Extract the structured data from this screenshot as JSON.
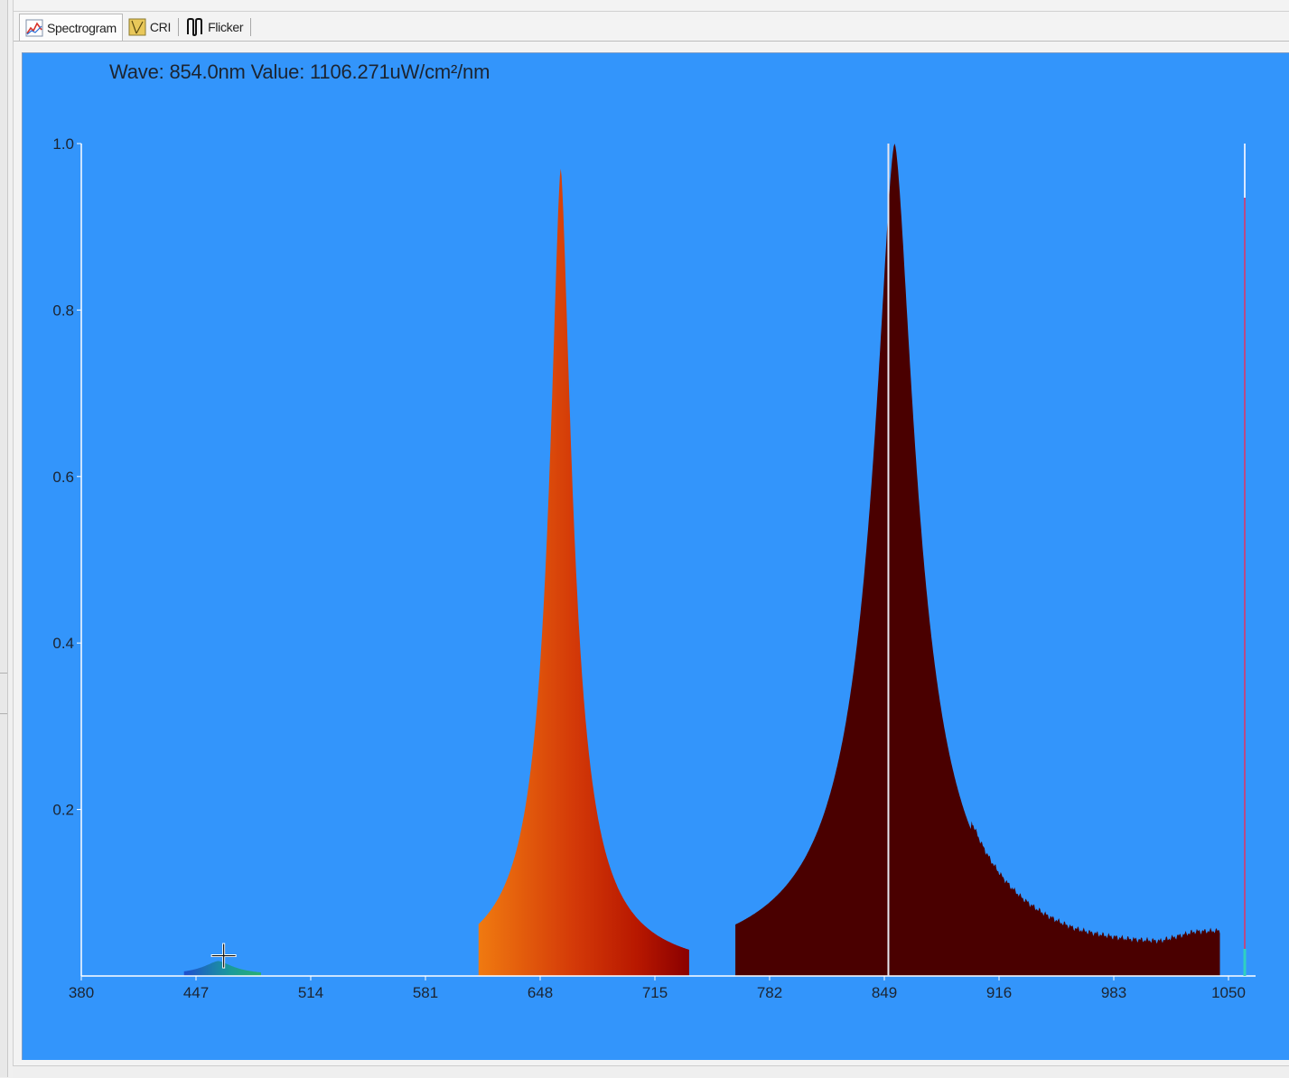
{
  "tabs": [
    {
      "label": "Spectrogram",
      "icon": "spectrogram-icon",
      "active": true
    },
    {
      "label": "CRI",
      "icon": "cri-icon",
      "active": false
    },
    {
      "label": "Flicker",
      "icon": "flicker-icon",
      "active": false
    }
  ],
  "readout": "Wave: 854.0nm Value: 1106.271uW/cm²/nm",
  "colors": {
    "plot_background": "#3395fb",
    "axis": "#ffffff",
    "cursor_line": "#e8e8f0",
    "deep_red": "#4a0000"
  },
  "chart_data": {
    "type": "area",
    "title": "",
    "xlabel": "",
    "ylabel": "",
    "xlim": [
      380,
      1050
    ],
    "ylim": [
      0,
      1.0
    ],
    "x_ticks": [
      380,
      447,
      514,
      581,
      648,
      715,
      782,
      849,
      916,
      983,
      1050
    ],
    "y_ticks": [
      0.2,
      0.4,
      0.6,
      0.8,
      1.0
    ],
    "y_tick_labels": [
      "0.2",
      "0.4",
      "0.6",
      "0.8",
      "1.0"
    ],
    "grid": false,
    "cursor_wavelength": 854.0,
    "peaks": [
      {
        "center": 460,
        "height": 0.018,
        "width": 12
      },
      {
        "center": 660,
        "height": 0.97,
        "width": 9
      },
      {
        "center": 855,
        "height": 1.0,
        "width": 17
      }
    ],
    "tail": [
      {
        "x": 900,
        "y": 0.012
      },
      {
        "x": 930,
        "y": 0.008
      },
      {
        "x": 960,
        "y": 0.006
      },
      {
        "x": 990,
        "y": 0.01
      },
      {
        "x": 1010,
        "y": 0.014
      },
      {
        "x": 1030,
        "y": 0.03
      },
      {
        "x": 1045,
        "y": 0.034
      }
    ]
  }
}
